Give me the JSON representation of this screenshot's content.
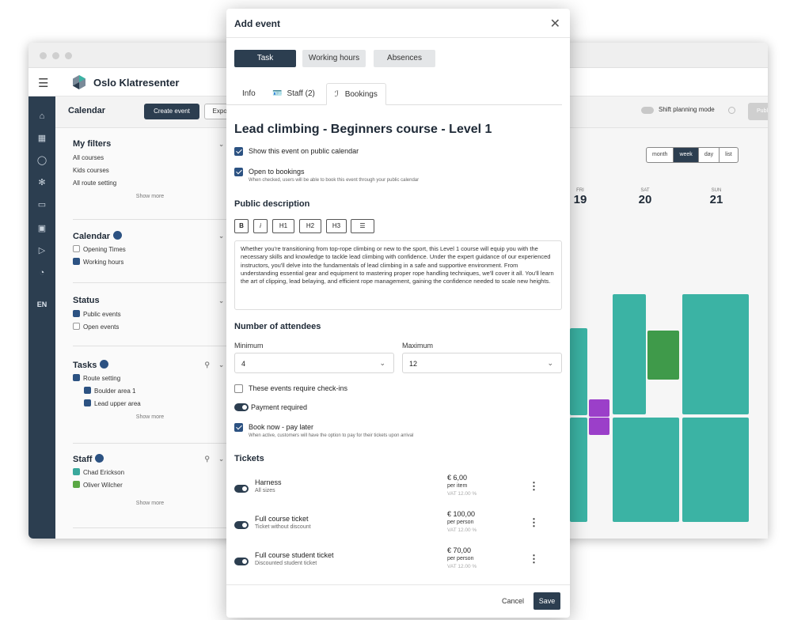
{
  "app": {
    "brand_name": "Oslo Klatresenter",
    "rail_lang": "EN"
  },
  "toolbar": {
    "title": "Calendar",
    "create_event": "Create event",
    "export_events": "Export events",
    "shift_planning": "Shift planning mode",
    "publish": "Publish"
  },
  "sidebar": {
    "my_filters": {
      "title": "My filters",
      "items": [
        "All courses",
        "Kids courses",
        "All route setting"
      ],
      "more": "Show more"
    },
    "calendar": {
      "title": "Calendar",
      "items": [
        "Opening Times",
        "Working hours"
      ]
    },
    "status": {
      "title": "Status",
      "items": [
        "Public events",
        "Open events"
      ]
    },
    "tasks": {
      "title": "Tasks",
      "items": [
        "Route setting",
        "Boulder area 1",
        "Lead upper area"
      ],
      "more": "Show more"
    },
    "staff": {
      "title": "Staff",
      "items": [
        "Chad Erickson",
        "Oliver Wilcher"
      ],
      "more": "Show more"
    }
  },
  "calendar": {
    "views": [
      "month",
      "week",
      "day",
      "list"
    ],
    "active_view": "week",
    "days": [
      {
        "name": "FRI",
        "num": "19"
      },
      {
        "name": "SAT",
        "num": "20"
      },
      {
        "name": "SUN",
        "num": "21"
      }
    ]
  },
  "modal": {
    "title": "Add event",
    "segments": [
      "Task",
      "Working hours",
      "Absences"
    ],
    "tabs": {
      "info": "Info",
      "staff": "Staff (2)",
      "bookings": "Bookings"
    },
    "event_title": "Lead climbing - Beginners course - Level 1",
    "show_public": "Show this event on public calendar",
    "open_bookings": "Open to bookings",
    "open_bookings_hint": "When checked, users will be able to book this event through your public calendar",
    "public_description_heading": "Public description",
    "format_buttons": [
      "B",
      "i",
      "H1",
      "H2",
      "H3"
    ],
    "description": "Whether you're transitioning from top-rope climbing or new to the sport, this Level 1 course will equip you with the necessary skills and knowledge to tackle lead climbing with confidence. Under the expert guidance of our experienced instructors, you'll delve into the fundamentals of lead climbing in a safe and supportive environment. From understanding essential gear and equipment to mastering proper rope handling techniques, we'll cover it all. You'll learn the art of clipping, lead belaying, and efficient rope management, gaining the confidence needed to scale new heights.",
    "attendees_heading": "Number of attendees",
    "minimum_label": "Minimum",
    "minimum_value": "4",
    "maximum_label": "Maximum",
    "maximum_value": "12",
    "checkins": "These events require check-ins",
    "payment_required": "Payment required",
    "book_now": "Book now - pay later",
    "book_now_hint": "When active, customers will have the option to pay for their tickets upon arrival",
    "tickets_heading": "Tickets",
    "tickets": [
      {
        "name": "Harness",
        "desc": "All sizes",
        "price": "€ 6,00",
        "unit": "per item",
        "vat": "VAT 12.00 %"
      },
      {
        "name": "Full course ticket",
        "desc": "Ticket without discount",
        "price": "€ 100,00",
        "unit": "per person",
        "vat": "VAT 12.00 %"
      },
      {
        "name": "Full course student ticket",
        "desc": "Discounted student ticket",
        "price": "€ 70,00",
        "unit": "per person",
        "vat": "VAT 12.00 %"
      }
    ],
    "cancel": "Cancel",
    "save": "Save"
  }
}
